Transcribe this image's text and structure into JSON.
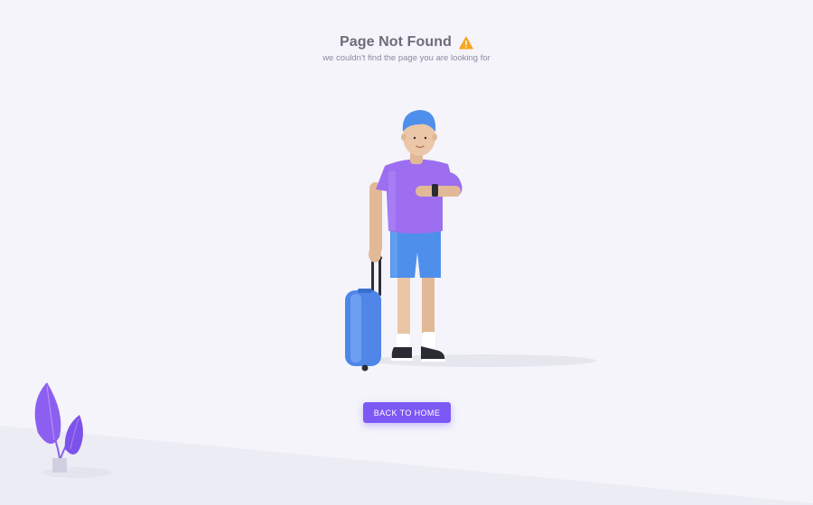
{
  "header": {
    "title": "Page Not Found",
    "subtitle": "we couldn't find the page you are looking for"
  },
  "actions": {
    "back_home_label": "BACK TO HOME"
  },
  "icons": {
    "title_icon": "warning-icon",
    "illustration": "traveler-with-suitcase-illustration",
    "decoration": "plant-icon"
  },
  "colors": {
    "background": "#f4f4fa",
    "title": "#6e6b7b",
    "subtitle": "#8e8ba0",
    "primary": "#7c58f5",
    "warning": "#f5a623"
  }
}
